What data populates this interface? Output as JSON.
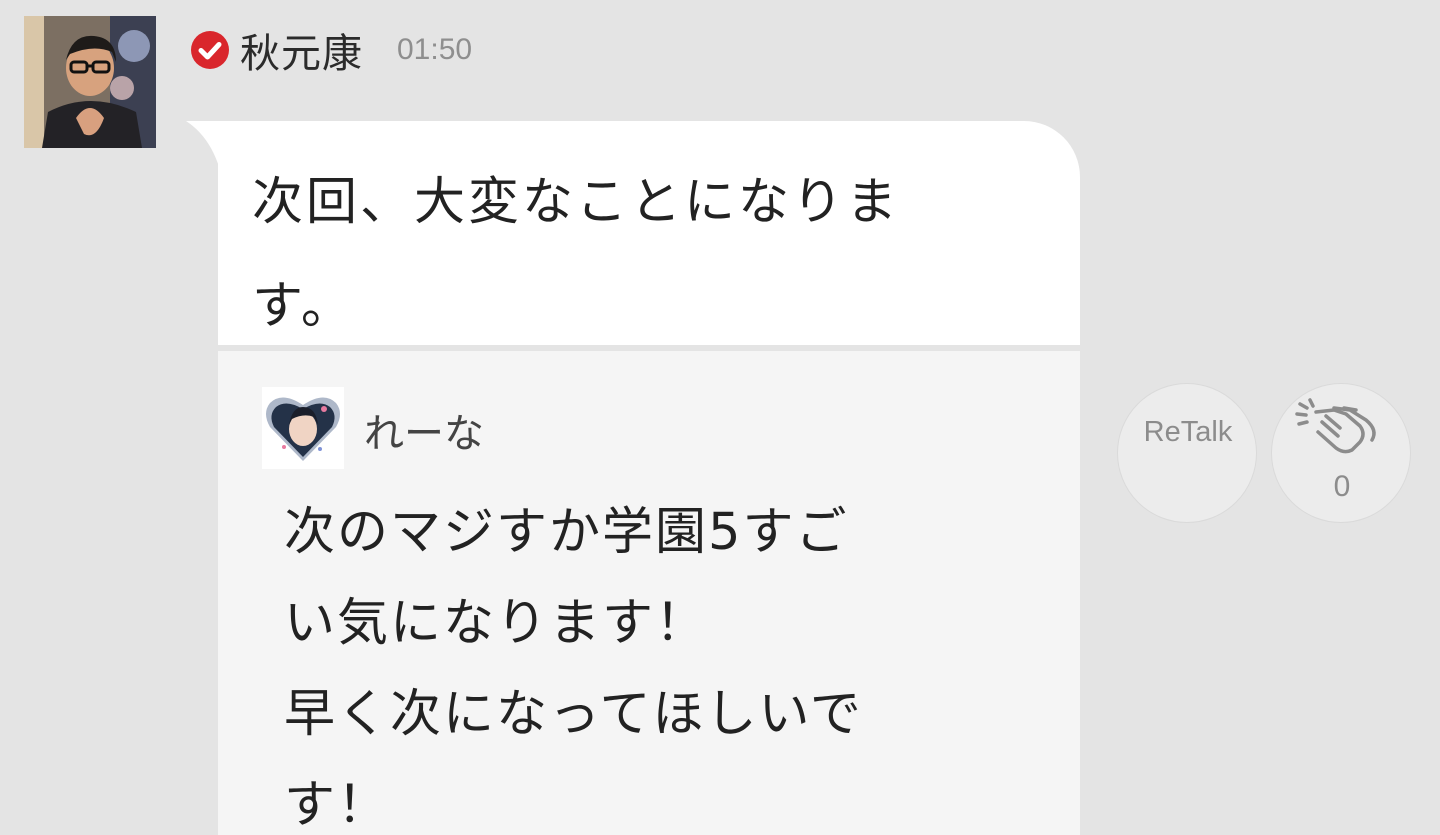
{
  "post": {
    "author": "秋元康",
    "time": "01:50",
    "message_lines": [
      "次回、大変なことになりま",
      "す。"
    ]
  },
  "quote": {
    "author": "れーな",
    "message_lines": [
      "次のマジすか学園5すご",
      "い気になります！",
      "早く次になってほしいで",
      "す！"
    ]
  },
  "actions": {
    "retalk_label": "ReTalk",
    "clap_count": "0"
  },
  "icons": {
    "verified": "check-badge-icon",
    "clap": "clap-icon"
  },
  "colors": {
    "background": "#e4e4e4",
    "bubble": "#ffffff",
    "quote_background": "#f5f5f5",
    "verified_badge": "#d9262c",
    "muted_text": "#8e8e8e"
  }
}
